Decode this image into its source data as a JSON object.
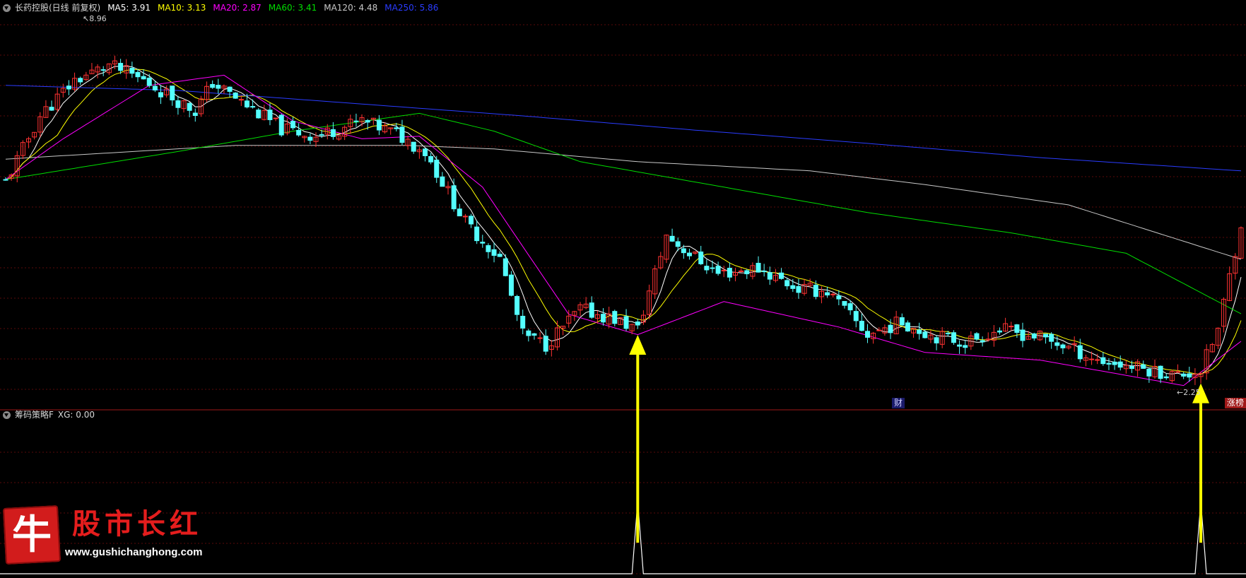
{
  "main_header": {
    "title": "长药控股(日线 前复权)",
    "ma": [
      {
        "label": "MA5: 3.91",
        "color": "#ffffff"
      },
      {
        "label": "MA10: 3.13",
        "color": "#ffff00"
      },
      {
        "label": "MA20: 2.87",
        "color": "#ff00ff"
      },
      {
        "label": "MA60: 3.41",
        "color": "#00dd00"
      },
      {
        "label": "MA120: 4.48",
        "color": "#c8c8c8"
      },
      {
        "label": "MA250: 5.86",
        "color": "#2a3cff"
      }
    ]
  },
  "sub_header": {
    "title": "筹码策略F",
    "xg": "XG: 0.00"
  },
  "notes": {
    "high": "8.96",
    "low": "2.25"
  },
  "badges": {
    "cai": "财",
    "zhangbang": "涨榜"
  },
  "logo": {
    "char": "牛",
    "brand": "股市长红",
    "url": "www.gushichanghong.com"
  },
  "colors": {
    "up": "#ff3232",
    "down": "#54ffff",
    "panel_divider": "#a01818",
    "grid": "#5a0a0a",
    "signal": "#ffffff",
    "arrow": "#ffff00",
    "ma5": "#ffffff",
    "ma10": "#ffff00",
    "ma20": "#ff00ff",
    "ma60": "#00dd00",
    "ma120": "#c8c8c8",
    "ma250": "#2a3cff"
  },
  "chart_data": {
    "type": "candlestick",
    "series": [
      {
        "name": "MA250",
        "color": "#2a3cff",
        "values": [
          [
            0,
            7.9
          ],
          [
            30,
            7.8
          ],
          [
            60,
            7.55
          ],
          [
            90,
            7.3
          ],
          [
            120,
            7.02
          ],
          [
            150,
            6.76
          ],
          [
            180,
            6.48
          ],
          [
            215,
            6.22
          ]
        ]
      },
      {
        "name": "MA120",
        "color": "#c8c8c8",
        "values": [
          [
            0,
            6.45
          ],
          [
            40,
            6.72
          ],
          [
            70,
            6.72
          ],
          [
            85,
            6.65
          ],
          [
            110,
            6.4
          ],
          [
            140,
            6.22
          ],
          [
            160,
            5.95
          ],
          [
            185,
            5.55
          ],
          [
            215,
            4.48
          ]
        ]
      },
      {
        "name": "MA60",
        "color": "#00dd00",
        "values": [
          [
            0,
            6.05
          ],
          [
            30,
            6.6
          ],
          [
            50,
            7.0
          ],
          [
            72,
            7.35
          ],
          [
            85,
            7.0
          ],
          [
            100,
            6.4
          ],
          [
            125,
            5.9
          ],
          [
            150,
            5.4
          ],
          [
            175,
            5.0
          ],
          [
            195,
            4.6
          ],
          [
            215,
            3.41
          ]
        ]
      },
      {
        "name": "MA20",
        "color": "#ff00ff",
        "values": [
          [
            0,
            6.05
          ],
          [
            10,
            6.85
          ],
          [
            25,
            7.9
          ],
          [
            38,
            8.1
          ],
          [
            50,
            7.2
          ],
          [
            62,
            6.85
          ],
          [
            72,
            6.9
          ],
          [
            83,
            5.9
          ],
          [
            98,
            3.4
          ],
          [
            110,
            3.0
          ],
          [
            125,
            3.65
          ],
          [
            145,
            3.15
          ],
          [
            160,
            2.65
          ],
          [
            180,
            2.5
          ],
          [
            205,
            2.0
          ],
          [
            215,
            2.87
          ]
        ]
      }
    ],
    "arrows_at_x": [
      110,
      208
    ],
    "signal_spikes_x": [
      110,
      208
    ]
  }
}
